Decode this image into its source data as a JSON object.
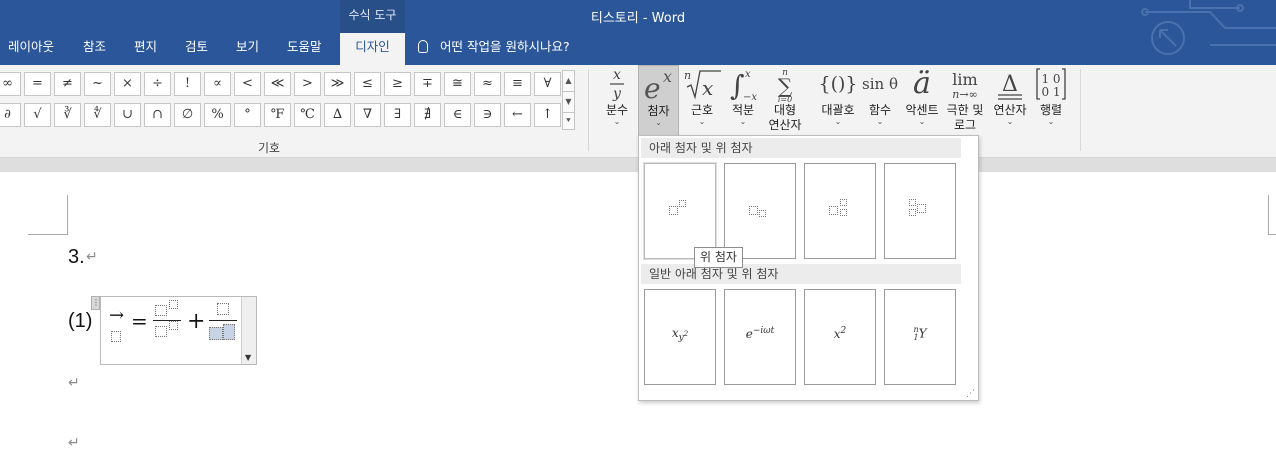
{
  "window": {
    "title": "티스토리  -  Word",
    "context_tool": "수식 도구"
  },
  "tabs": [
    {
      "label": "레이아웃"
    },
    {
      "label": "참조"
    },
    {
      "label": "편지"
    },
    {
      "label": "검토"
    },
    {
      "label": "보기"
    },
    {
      "label": "도움말"
    },
    {
      "label": "디자인"
    }
  ],
  "tell_me": "어떤 작업을 원하시나요?",
  "symbols": {
    "row1": [
      "∞",
      "=",
      "≠",
      "~",
      "×",
      "÷",
      "!",
      "∝",
      "<",
      "≪",
      ">",
      "≫",
      "≤",
      "≥",
      "∓",
      "≅",
      "≈",
      "≡",
      "∀"
    ],
    "row2": [
      "∂",
      "√",
      "∛",
      "∜",
      "∪",
      "∩",
      "∅",
      "%",
      "°",
      "℉",
      "℃",
      "∆",
      "∇",
      "∃",
      "∄",
      "∈",
      "∋",
      "←",
      "↑"
    ],
    "group_label": "기호"
  },
  "structures": [
    {
      "glyph": "x/y",
      "label": "분수"
    },
    {
      "glyph": "eˣ",
      "label": "첨자"
    },
    {
      "glyph": "ⁿ√x",
      "label": "근호"
    },
    {
      "glyph": "∫",
      "label": "적분"
    },
    {
      "glyph": "∑",
      "label_line1": "대형",
      "label_line2": "연산자"
    },
    {
      "glyph": "{()}",
      "label": "대괄호"
    },
    {
      "glyph": "sinθ",
      "label": "함수"
    },
    {
      "glyph": "ä",
      "label": "악센트"
    },
    {
      "glyph": "lim",
      "label_line1": "극한 및",
      "label_line2": "로그"
    },
    {
      "glyph": "Δ",
      "label": "연산자"
    },
    {
      "glyph": "[10 01]",
      "label": "행렬"
    }
  ],
  "document": {
    "para1": "3.",
    "eq_number": "(1)",
    "eq_arrow": "→",
    "eq_equals": "=",
    "eq_plus": "+",
    "para_mark": "↵"
  },
  "gallery": {
    "section1": "아래 첨자 및 위 첨자",
    "section2": "일반 아래 첨자 및 위 첨자",
    "examples": [
      "x_{y²}",
      "e^{−iωt}",
      "x²",
      "ⁿ₁Y"
    ],
    "ex1_base": "x",
    "ex1_sub": "y",
    "ex1_subsup": "2",
    "ex2_base": "e",
    "ex2_sup": "−iωt",
    "ex3_base": "x",
    "ex3_sup": "2",
    "ex4_sup": "n",
    "ex4_sub": "1",
    "ex4_base": "Y",
    "tooltip": "위 첨자"
  }
}
